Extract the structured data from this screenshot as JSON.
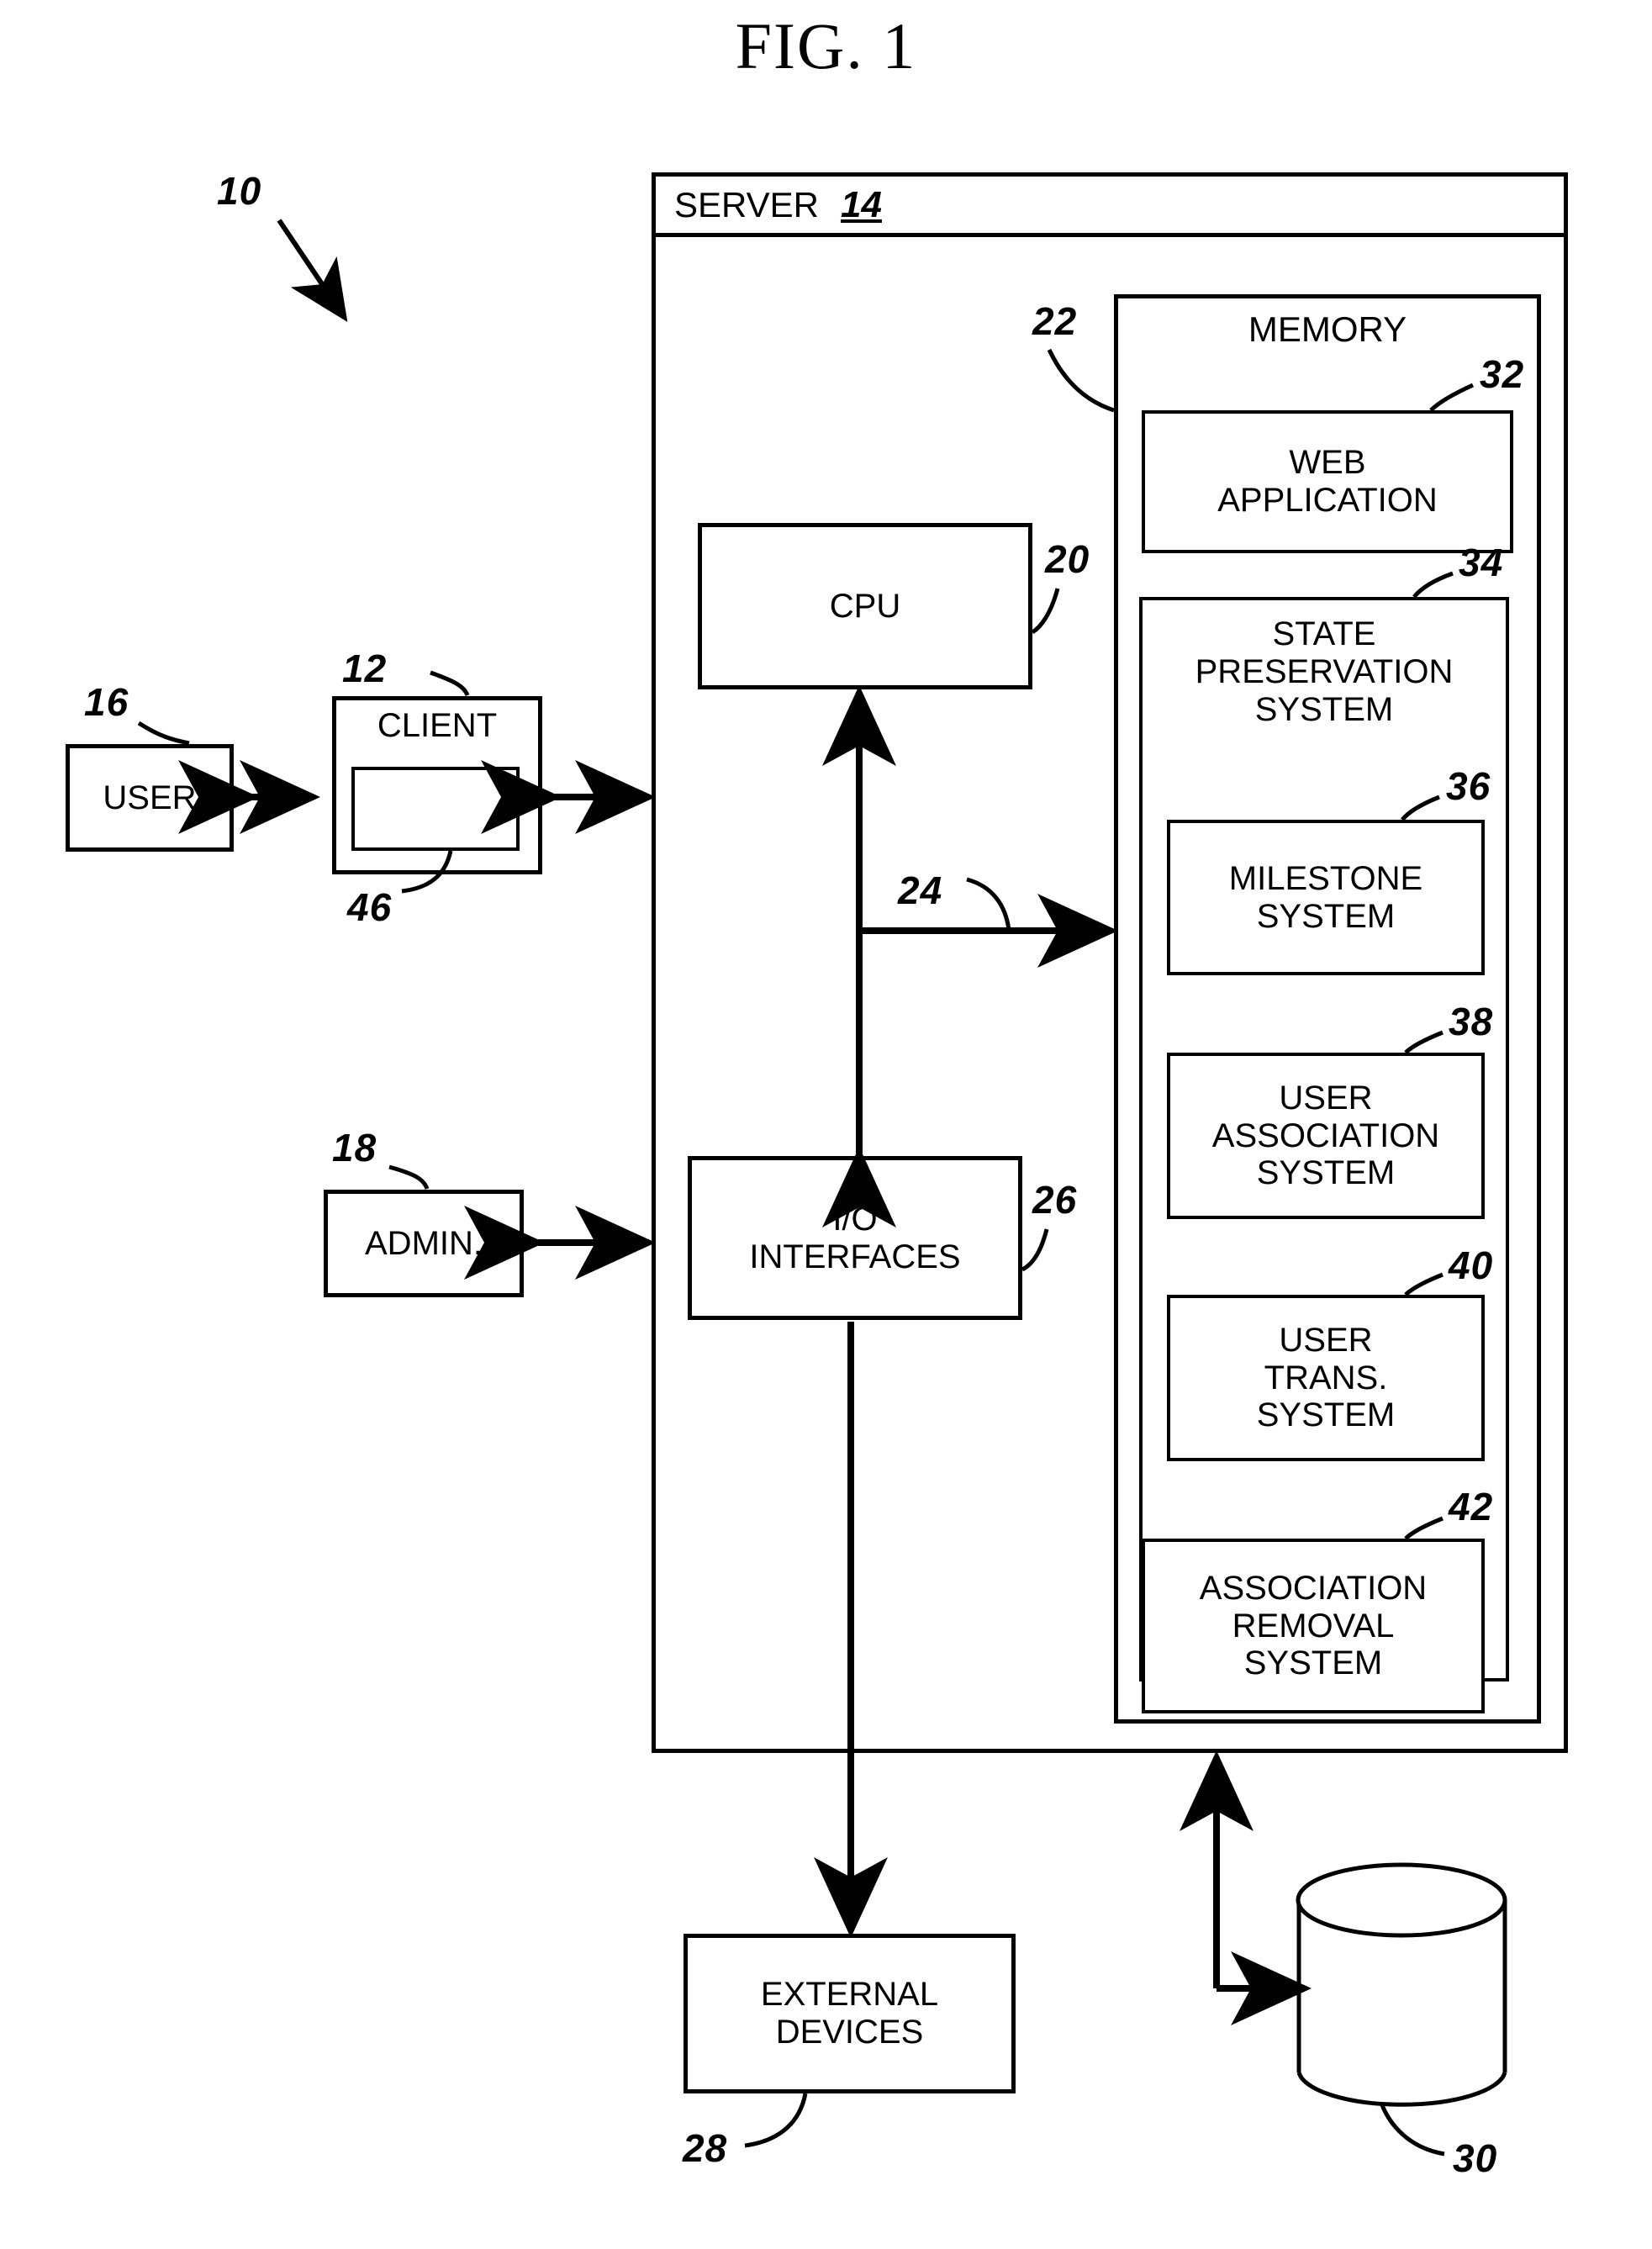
{
  "figure": {
    "title": "FIG. 1",
    "overall_ref": "10"
  },
  "blocks": {
    "user": {
      "label": "USER",
      "ref": "16"
    },
    "client": {
      "label": "CLIENT",
      "ref": "12"
    },
    "client_inner": {
      "label": "",
      "ref": "46"
    },
    "admin": {
      "label": "ADMIN.",
      "ref": "18"
    },
    "server": {
      "label": "SERVER",
      "ref": "14"
    },
    "cpu": {
      "label": "CPU",
      "ref": "20"
    },
    "bus": {
      "label": "",
      "ref": "24"
    },
    "io": {
      "label": "I/O\nINTERFACES",
      "ref": "26"
    },
    "memory": {
      "label": "MEMORY",
      "ref": "22"
    },
    "web_app": {
      "label": "WEB\nAPPLICATION",
      "ref": "32"
    },
    "state_pres": {
      "label": "STATE\nPRESERVATION\nSYSTEM",
      "ref": "34"
    },
    "milestone": {
      "label": "MILESTONE\nSYSTEM",
      "ref": "36"
    },
    "user_assoc": {
      "label": "USER\nASSOCIATION\nSYSTEM",
      "ref": "38"
    },
    "user_trans": {
      "label": "USER\nTRANS.\nSYSTEM",
      "ref": "40"
    },
    "assoc_removal": {
      "label": "ASSOCIATION\nREMOVAL\nSYSTEM",
      "ref": "42"
    },
    "external": {
      "label": "EXTERNAL\nDEVICES",
      "ref": "28"
    },
    "database": {
      "label": "",
      "ref": "30"
    }
  },
  "colors": {
    "line": "#000000",
    "background": "#ffffff"
  }
}
